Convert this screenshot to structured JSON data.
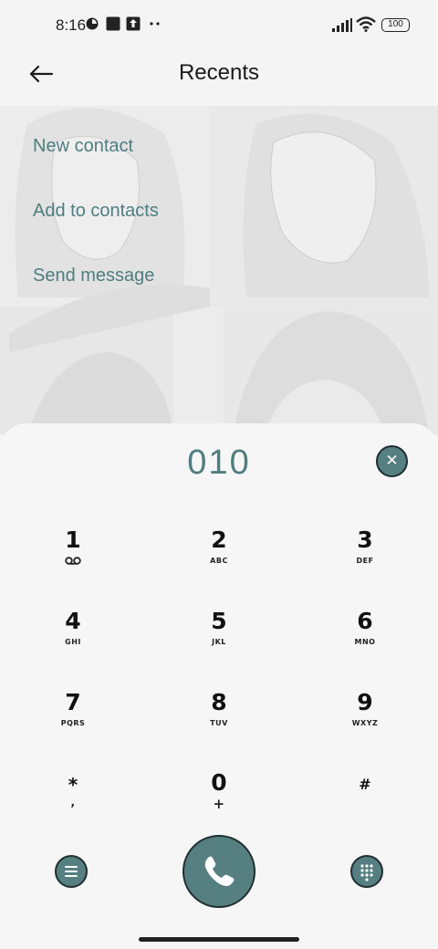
{
  "status_bar": {
    "time": "8:16",
    "battery": "100",
    "icons": [
      "hotspot-icon",
      "square-icon",
      "upload-icon",
      "more-dots-icon",
      "signal-icon",
      "wifi-icon",
      "battery-icon"
    ]
  },
  "header": {
    "title": "Recents",
    "back_icon": "back-arrow-icon"
  },
  "suggestions": [
    {
      "label": "New contact"
    },
    {
      "label": "Add to contacts"
    },
    {
      "label": "Send message"
    }
  ],
  "dialer": {
    "number": "010",
    "clear_icon": "close-icon",
    "keys": [
      {
        "digit": "1",
        "letters": ""
      },
      {
        "digit": "2",
        "letters": "ABC"
      },
      {
        "digit": "3",
        "letters": "DEF"
      },
      {
        "digit": "4",
        "letters": "GHI"
      },
      {
        "digit": "5",
        "letters": "JKL"
      },
      {
        "digit": "6",
        "letters": "MNO"
      },
      {
        "digit": "7",
        "letters": "PQRS"
      },
      {
        "digit": "8",
        "letters": "TUV"
      },
      {
        "digit": "9",
        "letters": "WXYZ"
      },
      {
        "digit": "*",
        "letters": ","
      },
      {
        "digit": "0",
        "letters": "+"
      },
      {
        "digit": "#",
        "letters": ""
      }
    ],
    "voicemail_icon": "voicemail-icon",
    "menu_icon": "menu-icon",
    "call_icon": "phone-icon",
    "keypad_icon": "dialpad-icon"
  },
  "colors": {
    "accent": "#4f7d80",
    "button_fill": "#557f80",
    "button_border": "#1f2e30",
    "background": "#f4f4f4"
  }
}
